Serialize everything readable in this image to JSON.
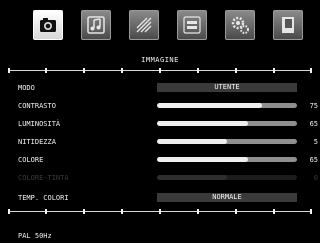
{
  "tabs": [
    {
      "name": "camera-icon",
      "active": true
    },
    {
      "name": "music-icon",
      "active": false
    },
    {
      "name": "brush-icon",
      "active": false
    },
    {
      "name": "cable-icon",
      "active": false
    },
    {
      "name": "gear-icon",
      "active": false
    },
    {
      "name": "book-icon",
      "active": false
    }
  ],
  "menu": {
    "title": "IMMAGINE",
    "modo": {
      "label": "MODO",
      "value": "UTENTE"
    },
    "contrasto": {
      "label": "CONTRASTO",
      "value": "75",
      "level": 0.75
    },
    "luminosita": {
      "label": "LUMINOSITÀ",
      "value": "65",
      "level": 0.65
    },
    "nitidezza": {
      "label": "NITIDEZZA",
      "value": "5",
      "level": 0.5
    },
    "colore": {
      "label": "COLORE",
      "value": "65",
      "level": 0.65
    },
    "colore_tinta": {
      "label": "COLORE-TINTA",
      "value": "0",
      "level": 0.5
    },
    "temp_colori": {
      "label": "TEMP. COLORI",
      "value": "NORMALE"
    }
  },
  "status": "PAL 50Hz"
}
